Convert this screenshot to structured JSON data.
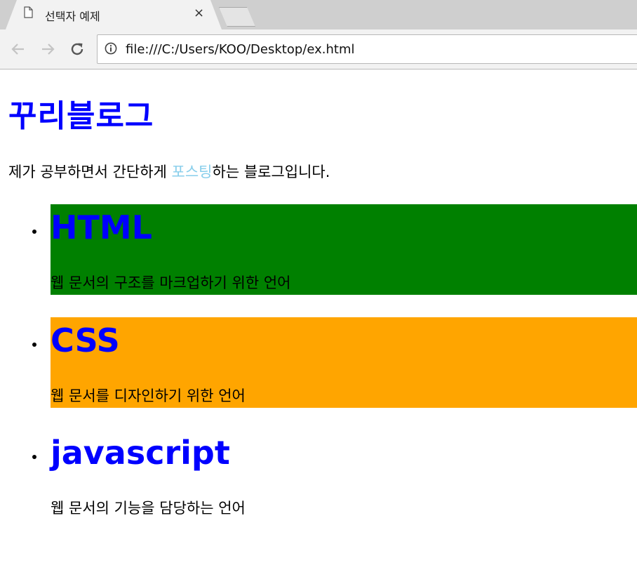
{
  "browser": {
    "tab_title": "선택자 예제",
    "tab_close": "×",
    "url": "file:///C:/Users/KOO/Desktop/ex.html"
  },
  "page": {
    "title": "꾸리블로그",
    "intro_before": "제가 공부하면서 간단하게 ",
    "intro_link": "포스팅",
    "intro_after": "하는 블로그입니다.",
    "topics": [
      {
        "heading": "HTML",
        "description": "웹 문서의 구조를 마크업하기 위한 언어",
        "background": "#008000"
      },
      {
        "heading": "CSS",
        "description": "웹 문서를 디자인하기 위한 언어",
        "background": "#ffa500"
      },
      {
        "heading": "javascript",
        "description": "웹 문서의 기능을 담당하는 언어",
        "background": ""
      }
    ]
  },
  "colors": {
    "heading": "#0000ff",
    "link": "#87ceeb"
  },
  "icons": {
    "tab": "document-icon",
    "close": "close-icon",
    "back": "back-arrow-icon",
    "forward": "forward-arrow-icon",
    "reload": "reload-icon",
    "site_info": "info-icon"
  }
}
